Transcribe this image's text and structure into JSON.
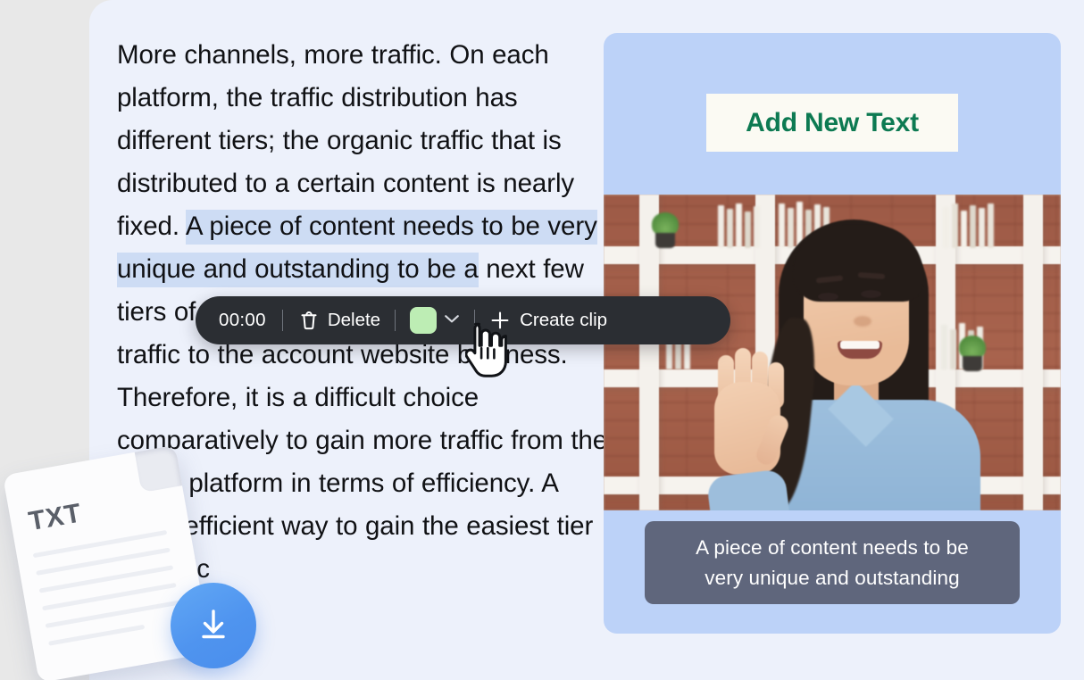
{
  "theme": {
    "page_background": "#e8e8e8",
    "panel_background": "#edf1fb",
    "preview_card_background": "#bcd2f8",
    "toolbar_background": "#2b2e33",
    "selection_highlight": "#cddcf4",
    "accent_green": "#0d7a52",
    "swatch_color": "#bdedb4",
    "caption_background": "#5f667c",
    "download_button_color": "#4f94ef"
  },
  "transcript": {
    "before_selection": "More channels, more traffic. On each platform, the traffic distribution has different tiers; the organic traffic that is distributed to a certain content is nearly fixed. ",
    "selection": "A piece of content needs to be very unique and outstanding to be a",
    "after_selection": " next few tiers of traffic, which would drive more traffic to the account website business. Therefore, it is a difficult choice comparatively to gain more traffic from the same platform in terms of efficiency. A more efficient way to gain the easiest tier of traffic"
  },
  "toolbar": {
    "timecode": "00:00",
    "delete_label": "Delete",
    "create_clip_label": "Create clip",
    "swatch_color": "#bdedb4",
    "delete_icon": "trash-icon",
    "chevron_icon": "chevron-down-icon",
    "plus_icon": "plus-icon"
  },
  "file_widget": {
    "file_type_label": "TXT",
    "download_icon": "download-arrow-icon"
  },
  "preview": {
    "add_text_label": "Add New Text",
    "caption_line_1": "A piece of content needs to be",
    "caption_line_2": "very unique and outstanding"
  },
  "cursor": {
    "icon": "pointing-hand-cursor"
  }
}
